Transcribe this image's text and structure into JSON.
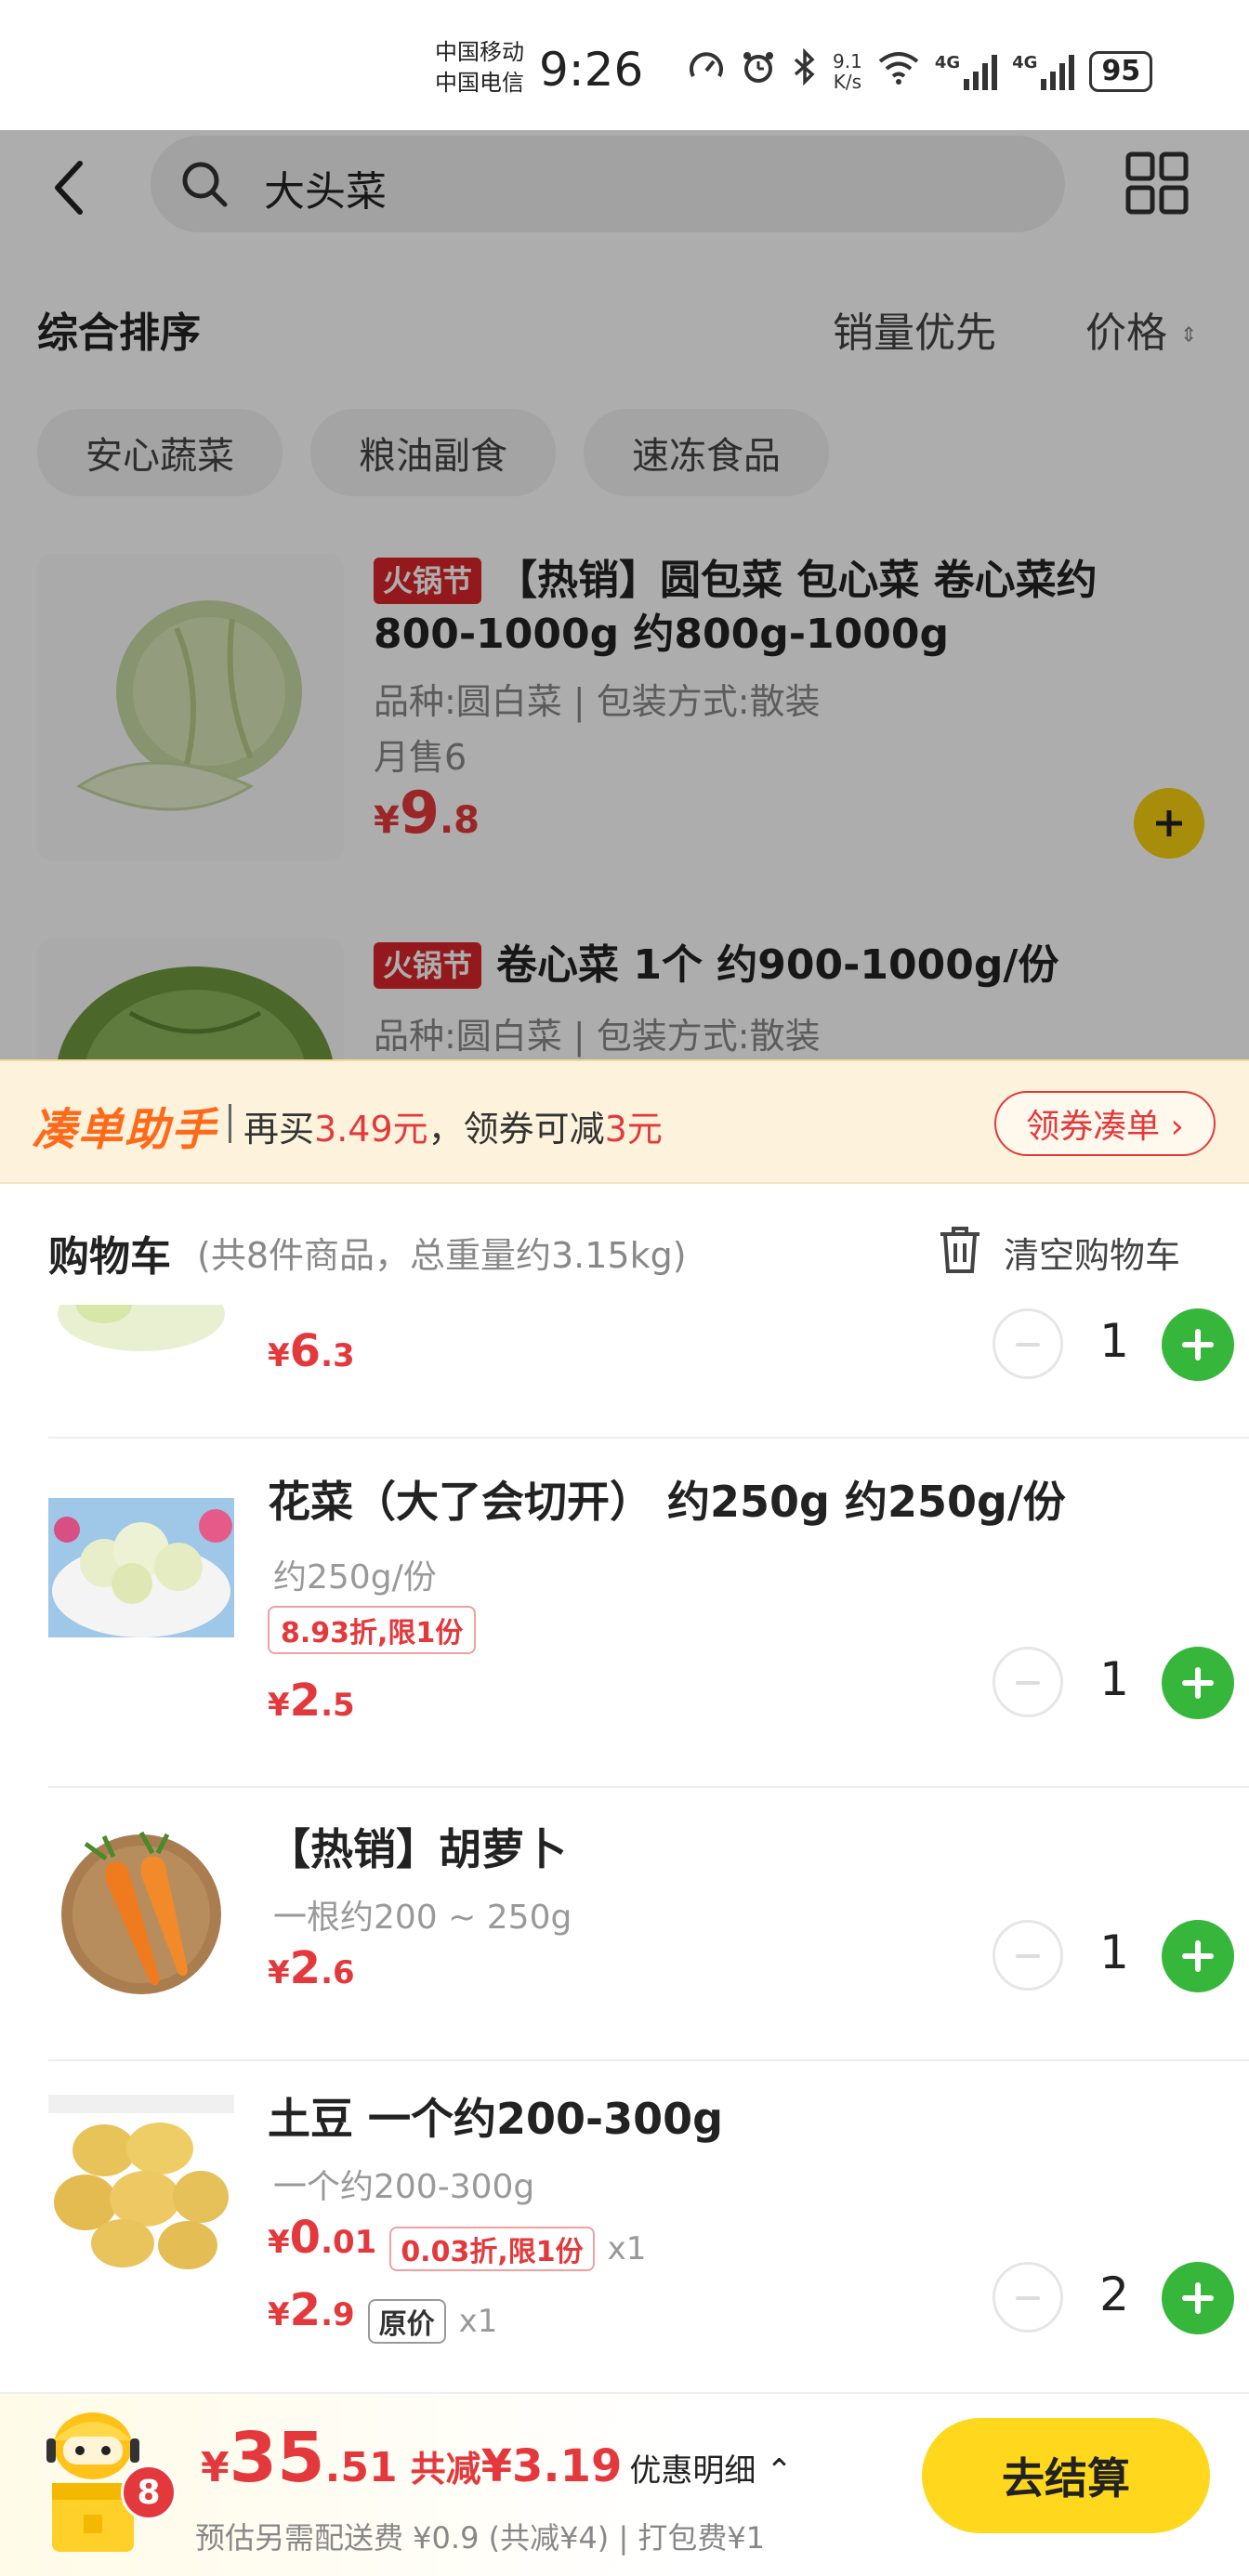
{
  "status_bar": {
    "carrier_1": "中国移动",
    "carrier_2": "中国电信",
    "time": "9:26",
    "net_speed_top": "9.1",
    "net_speed_bottom": "K/s",
    "signal_1": "4G",
    "signal_2": "4G",
    "battery": "95"
  },
  "search": {
    "query": "大头菜"
  },
  "sort_bar": {
    "default": "综合排序",
    "sales": "销量优先",
    "price": "价格"
  },
  "chips": [
    "安心蔬菜",
    "粮油副食",
    "速冻食品"
  ],
  "products": [
    {
      "tag": "火锅节",
      "title": "【热销】圆包菜 包心菜 卷心菜约800-1000g 约800g-1000g",
      "spec": "品种:圆白菜 | 包装方式:散装",
      "sold": "月售6",
      "price_cur": "¥",
      "price_int": "9",
      "price_dec": ".8"
    },
    {
      "tag": "火锅节",
      "title": "卷心菜 1个 约900-1000g/份",
      "spec": "品种:圆白菜 | 包装方式:散装"
    }
  ],
  "helper": {
    "logo": "凑单助手",
    "text_a": "再买",
    "amount": "3.49元",
    "text_b": "，领券可减",
    "discount": "3元",
    "button": "领券凑单 ›"
  },
  "cart": {
    "title": "购物车",
    "summary": "(共8件商品，总重量约3.15kg)",
    "clear": "清空购物车",
    "items": [
      {
        "price_cur": "¥",
        "price_int": "6",
        "price_dec": ".3",
        "qty": "1"
      },
      {
        "name": "花菜（大了会切开） 约250g 约250g/份",
        "spec": "约250g/份",
        "badge": "8.93折,限1份",
        "price_cur": "¥",
        "price_int": "2",
        "price_dec": ".5",
        "qty": "1"
      },
      {
        "name": "【热销】胡萝卜",
        "spec": "一根约200 ~ 250g",
        "price_cur": "¥",
        "price_int": "2",
        "price_dec": ".6",
        "qty": "1"
      },
      {
        "name": "土豆 一个约200-300g",
        "spec": "一个约200-300g",
        "price1_cur": "¥",
        "price1_int": "0",
        "price1_dec": ".01",
        "price1_badge": "0.03折,限1份",
        "price1_mult": "x1",
        "price2_cur": "¥",
        "price2_int": "2",
        "price2_dec": ".9",
        "price2_badge": "原价",
        "price2_mult": "x1",
        "qty": "2"
      }
    ]
  },
  "checkout": {
    "count": "8",
    "total_cur": "¥",
    "total_int": "35",
    "total_dec": ".51",
    "save_label": "共减",
    "save_amount": "¥3.19",
    "detail": "优惠明细",
    "fee_line": "预估另需配送费 ¥0.9 (共减¥4) | 打包费¥1",
    "button": "去结算"
  },
  "colors": {
    "accent_red": "#e4393c",
    "green_plus": "#36b63b",
    "yellow_button": "#ffd81e",
    "helper_orange": "#ff6a1a"
  }
}
